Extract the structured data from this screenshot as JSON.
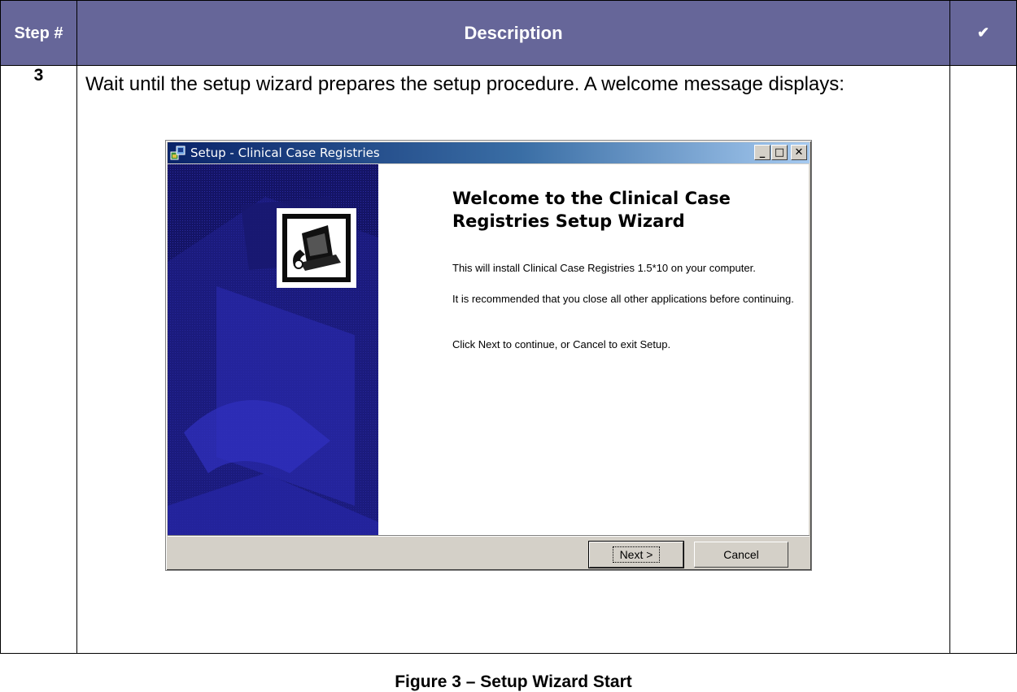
{
  "table": {
    "headers": {
      "step": "Step #",
      "description": "Description",
      "check": "✔"
    },
    "row": {
      "step_number": "3",
      "description": "Wait until the setup wizard prepares the setup procedure. A welcome message displays:",
      "caption": "Figure 3 – Setup Wizard Start"
    },
    "header_color": "#666699"
  },
  "wizard": {
    "title": "Setup - Clinical Case Registries",
    "heading": "Welcome to the Clinical Case Registries Setup Wizard",
    "line1": "This will install Clinical Case Registries 1.5*10 on your computer.",
    "line2": "It is recommended that you close all other applications before continuing.",
    "line3": "Click Next to continue, or Cancel to exit Setup.",
    "buttons": {
      "next": "Next >",
      "cancel": "Cancel"
    },
    "controls": {
      "minimize": "_",
      "maximize": "□",
      "close": "✕"
    },
    "icons": [
      "setup-app-icon",
      "computer-install-icon"
    ],
    "colors": {
      "titlebar": "#0a246a",
      "side_panel": "#1a1a7a"
    }
  }
}
